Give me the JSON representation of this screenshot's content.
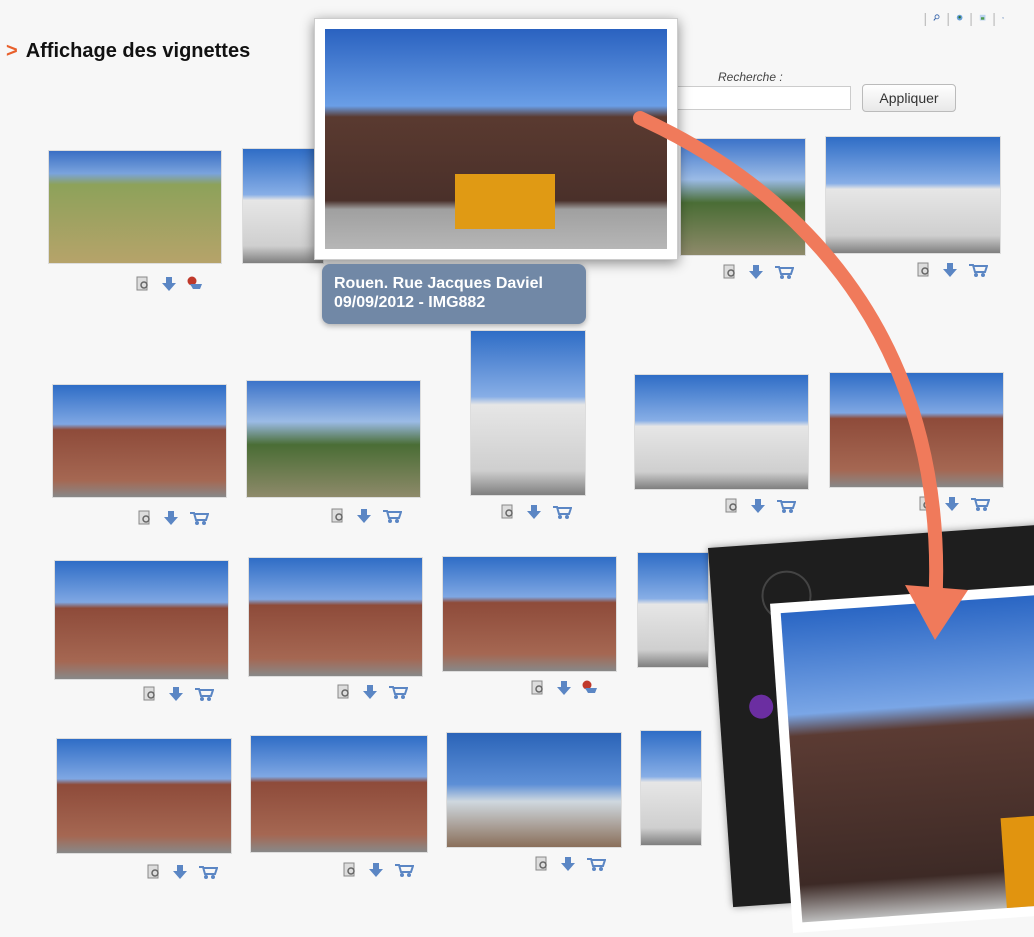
{
  "header": {
    "title_marker": ">",
    "title": "Affichage des vignettes"
  },
  "toolbar": {
    "icons": [
      "search-icon",
      "map-icon",
      "image-icon",
      "cart-icon"
    ]
  },
  "search": {
    "label": "Recherche :",
    "value": "",
    "button_label": "Appliquer"
  },
  "popup": {
    "caption_line1": "Rouen. Rue Jacques Daviel",
    "caption_line2": "09/09/2012 - IMG882"
  },
  "thumbnails_count": 20,
  "colors": {
    "accent": "#e8602c",
    "caption_bg": "#7188a6",
    "icon_blue": "#5b86c4",
    "icon_red": "#c0392b"
  }
}
